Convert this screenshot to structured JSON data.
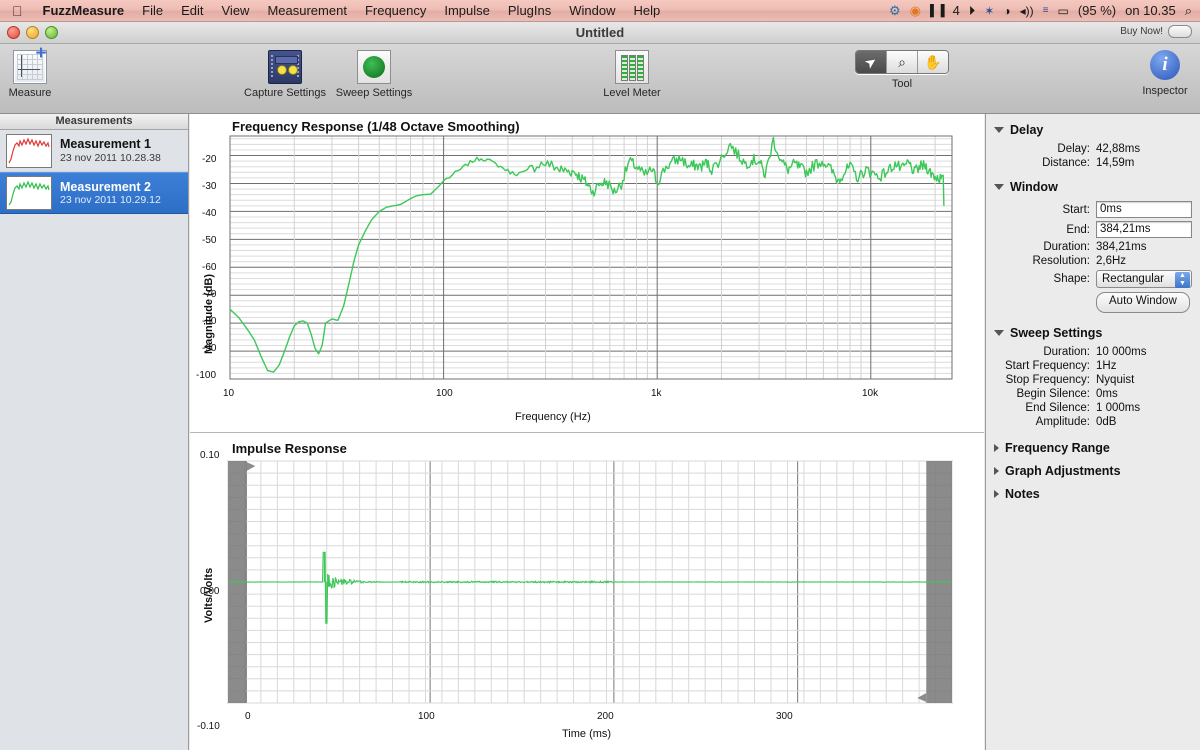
{
  "menubar": {
    "apple_icon": "apple-icon",
    "app_name": "FuzzMeasure",
    "items": [
      "File",
      "Edit",
      "View",
      "Measurement",
      "Frequency",
      "Impulse",
      "PlugIns",
      "Window",
      "Help"
    ],
    "status_items": [
      {
        "name": "dropbox-icon",
        "glyph": "⚙"
      },
      {
        "name": "app-status-icon",
        "glyph": "◉"
      },
      {
        "name": "audio-meter-icon",
        "glyph": "▌▐"
      },
      {
        "name": "audio-count-label",
        "glyph": "4"
      },
      {
        "name": "clock-history-icon",
        "glyph": "◴"
      },
      {
        "name": "bluetooth-icon",
        "glyph": "✶"
      },
      {
        "name": "wifi-icon",
        "glyph": "◔"
      },
      {
        "name": "volume-icon",
        "glyph": "◂))"
      },
      {
        "name": "keyboard-flag-icon",
        "glyph": "≡"
      },
      {
        "name": "battery-icon",
        "glyph": "▭"
      }
    ],
    "battery_percent": "(95 %)",
    "clock": "on 10.35",
    "search_icon": "search-icon"
  },
  "window": {
    "title": "Untitled",
    "buy_now_label": "Buy Now!"
  },
  "toolbar": {
    "measure_label": "Measure",
    "capture_settings_label": "Capture Settings",
    "sweep_settings_label": "Sweep Settings",
    "level_meter_label": "Level Meter",
    "tool_label": "Tool",
    "inspector_label": "Inspector",
    "tools": [
      {
        "name": "arrow-tool",
        "glyph": "➤",
        "selected": true
      },
      {
        "name": "zoom-tool",
        "glyph": "⌕",
        "selected": false
      },
      {
        "name": "pan-hand-tool",
        "glyph": "✋",
        "selected": false
      }
    ]
  },
  "sidebar": {
    "header": "Measurements",
    "items": [
      {
        "name": "Measurement 1",
        "date": "23 nov 2011 10.28.38",
        "color": "#e03a3a",
        "selected": false
      },
      {
        "name": "Measurement 2",
        "date": "23 nov 2011 10.29.12",
        "color": "#2fbf4a",
        "selected": true
      }
    ]
  },
  "inspector": {
    "sections": [
      {
        "title": "Delay",
        "open": true,
        "rows": [
          {
            "key": "Delay:",
            "value": "42,88ms"
          },
          {
            "key": "Distance:",
            "value": "14,59m"
          }
        ]
      },
      {
        "title": "Window",
        "open": true,
        "rows": [
          {
            "key": "Start:",
            "value": "0ms",
            "type": "field"
          },
          {
            "key": "End:",
            "value": "384,21ms",
            "type": "field"
          },
          {
            "key": "Duration:",
            "value": "384,21ms"
          },
          {
            "key": "Resolution:",
            "value": "2,6Hz"
          },
          {
            "key": "Shape:",
            "value": "Rectangular",
            "type": "popup"
          }
        ],
        "button": "Auto Window"
      },
      {
        "title": "Sweep Settings",
        "open": true,
        "rows": [
          {
            "key": "Duration:",
            "value": "10 000ms"
          },
          {
            "key": "Start Frequency:",
            "value": "1Hz"
          },
          {
            "key": "Stop Frequency:",
            "value": "Nyquist"
          },
          {
            "key": "Begin Silence:",
            "value": "0ms"
          },
          {
            "key": "End Silence:",
            "value": "1 000ms"
          },
          {
            "key": "Amplitude:",
            "value": "0dB"
          }
        ]
      },
      {
        "title": "Frequency Range",
        "open": false,
        "rows": []
      },
      {
        "title": "Graph Adjustments",
        "open": false,
        "rows": []
      },
      {
        "title": "Notes",
        "open": false,
        "rows": []
      }
    ]
  },
  "chart_data": [
    {
      "type": "line",
      "name": "frequency-response",
      "title": "Frequency Response (1/48 Octave Smoothing)",
      "xlabel": "Frequency (Hz)",
      "ylabel": "Magnitude (dB)",
      "xscale": "log",
      "xlim": [
        10,
        24000
      ],
      "ylim": [
        -100,
        -13
      ],
      "xticks": [
        "10",
        "100",
        "1k",
        "10k"
      ],
      "yticks": [
        "-20",
        "-30",
        "-40",
        "-50",
        "-60",
        "-70",
        "-80",
        "-90",
        "-100"
      ],
      "grid": true,
      "legend": "none",
      "series_color": "#3cc858",
      "series": [
        {
          "name": "Measurement 2",
          "x": [
            10,
            11,
            12,
            13,
            14,
            15,
            16,
            17,
            18,
            19,
            20,
            21,
            22,
            23,
            24,
            25,
            26,
            27,
            28,
            30,
            32,
            34,
            36,
            38,
            40,
            43,
            46,
            50,
            54,
            58,
            63,
            68,
            74,
            80,
            87,
            95,
            100,
            110,
            120,
            130,
            140,
            150,
            160,
            175,
            190,
            205,
            220,
            240,
            260,
            280,
            300,
            320,
            350,
            380,
            410,
            440,
            470,
            500,
            540,
            580,
            630,
            680,
            740,
            800,
            870,
            950,
            1000,
            1100,
            1200,
            1300,
            1400,
            1500,
            1600,
            1700,
            1800,
            2000,
            2200,
            2400,
            2600,
            2800,
            3000,
            3200,
            3500,
            3800,
            4100,
            4400,
            4700,
            5000,
            5500,
            6000,
            6500,
            7000,
            7500,
            8000,
            8700,
            9500,
            10000,
            11000,
            12000,
            13000,
            14000,
            15000,
            16000,
            17000,
            18000,
            19000,
            20000,
            21000,
            22000
          ],
          "y": [
            -75,
            -78,
            -82,
            -86,
            -92,
            -97,
            -97.5,
            -95,
            -90,
            -85,
            -81,
            -79.5,
            -79.2,
            -80,
            -84,
            -89,
            -91,
            -88,
            -80,
            -78.5,
            -79,
            -74,
            -66,
            -58,
            -52,
            -47,
            -43,
            -40,
            -38.5,
            -38,
            -37.5,
            -36,
            -34.5,
            -34,
            -33.8,
            -31,
            -29,
            -27,
            -25,
            -23,
            -21.5,
            -21,
            -21.5,
            -23,
            -24.5,
            -26,
            -26.5,
            -26,
            -24.5,
            -23,
            -22.8,
            -23.5,
            -25,
            -25.5,
            -25.8,
            -28,
            -30,
            -33,
            -30,
            -29.5,
            -33,
            -30,
            -22,
            -24,
            -27,
            -25,
            -29.5,
            -24,
            -22,
            -21,
            -24,
            -23.5,
            -24,
            -22.5,
            -25,
            -21,
            -16,
            -20,
            -23,
            -21.5,
            -22,
            -27,
            -14.5,
            -22,
            -25,
            -23,
            -24.5,
            -26,
            -23,
            -22,
            -25,
            -29,
            -26,
            -24,
            -28,
            -25,
            -26,
            -27.5,
            -25.5,
            -23,
            -25,
            -22.5,
            -26,
            -24,
            -23.5,
            -26,
            -27.5,
            -28,
            -29,
            -30,
            -33,
            -38
          ]
        }
      ]
    },
    {
      "type": "line",
      "name": "impulse-response",
      "title": "Impulse Response",
      "xlabel": "Time (ms)",
      "ylabel": "Volts/Volts",
      "xscale": "linear",
      "xlim": [
        -10,
        384
      ],
      "ylim": [
        -0.1,
        0.1
      ],
      "xticks": [
        "0",
        "100",
        "200",
        "300"
      ],
      "yticks": [
        "0.10",
        "0.00",
        "-0.10"
      ],
      "grid": true,
      "legend": "none",
      "series_color": "#3cc858",
      "window_shading": {
        "left_end_ms": 0,
        "right_start_ms": 370,
        "color": "#777777"
      },
      "impulse_peak_ms": 42.88,
      "impulse_peak_value": 0.0245,
      "impulse_min_value": -0.034
    }
  ]
}
